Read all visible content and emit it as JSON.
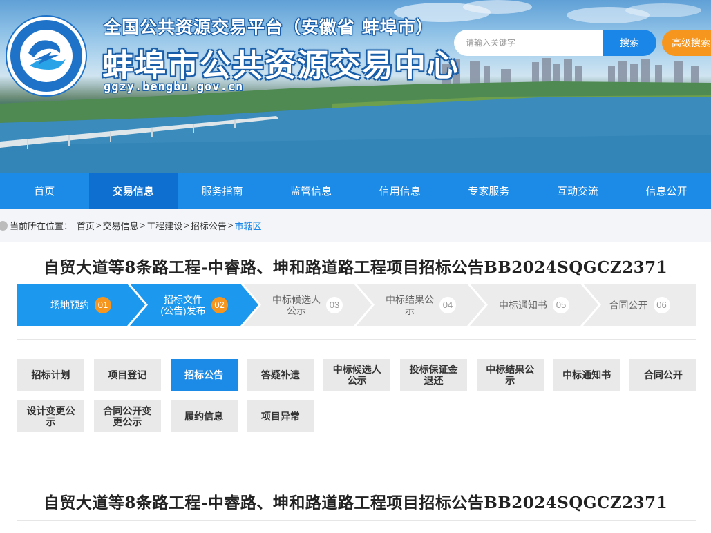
{
  "header": {
    "platform_title": "全国公共资源交易平台（安徽省 蚌埠市）",
    "center_title": "蚌埠市公共资源交易中心",
    "url": "ggzy.bengbu.gov.cn",
    "search_placeholder": "请输入关键字",
    "search_label": "搜索",
    "advanced_search_label": "高级搜索",
    "logo_text": "长三角区域公共资源交易一体化 高质量发展合作联盟成员"
  },
  "nav": {
    "items": [
      "首页",
      "交易信息",
      "服务指南",
      "监管信息",
      "信用信息",
      "专家服务",
      "互动交流",
      "信息公开"
    ],
    "active": "交易信息"
  },
  "breadcrumb": {
    "prefix": "当前所在位置：",
    "items": [
      "首页",
      "交易信息",
      "工程建设",
      "招标公告"
    ],
    "current": "市辖区"
  },
  "notice": {
    "title": "自贸大道等8条路工程-中睿路、坤和路道路工程项目招标公告BB2024SQGCZ2371"
  },
  "steps": [
    {
      "label": "场地预约",
      "num": "01",
      "state": "done"
    },
    {
      "label": "招标文件\n(公告)发布",
      "num": "02",
      "state": "done"
    },
    {
      "label": "中标候选人\n公示",
      "num": "03",
      "state": "todo"
    },
    {
      "label": "中标结果公\n示",
      "num": "04",
      "state": "todo"
    },
    {
      "label": "中标通知书",
      "num": "05",
      "state": "todo"
    },
    {
      "label": "合同公开",
      "num": "06",
      "state": "todo"
    }
  ],
  "tabs": {
    "row1": [
      "招标计划",
      "项目登记",
      "招标公告",
      "答疑补遗",
      "中标候选人\n公示",
      "投标保证金\n退还",
      "中标结果公\n示",
      "中标通知书",
      "合同公开"
    ],
    "row2": [
      "设计变更公\n示",
      "合同公开变\n更公示",
      "履约信息",
      "项目异常"
    ],
    "active": "招标公告"
  },
  "colors": {
    "nav_blue": "#1c8be8",
    "nav_active": "#0f6fd0",
    "step_done": "#1c98ef",
    "accent_orange": "#f7961e"
  }
}
